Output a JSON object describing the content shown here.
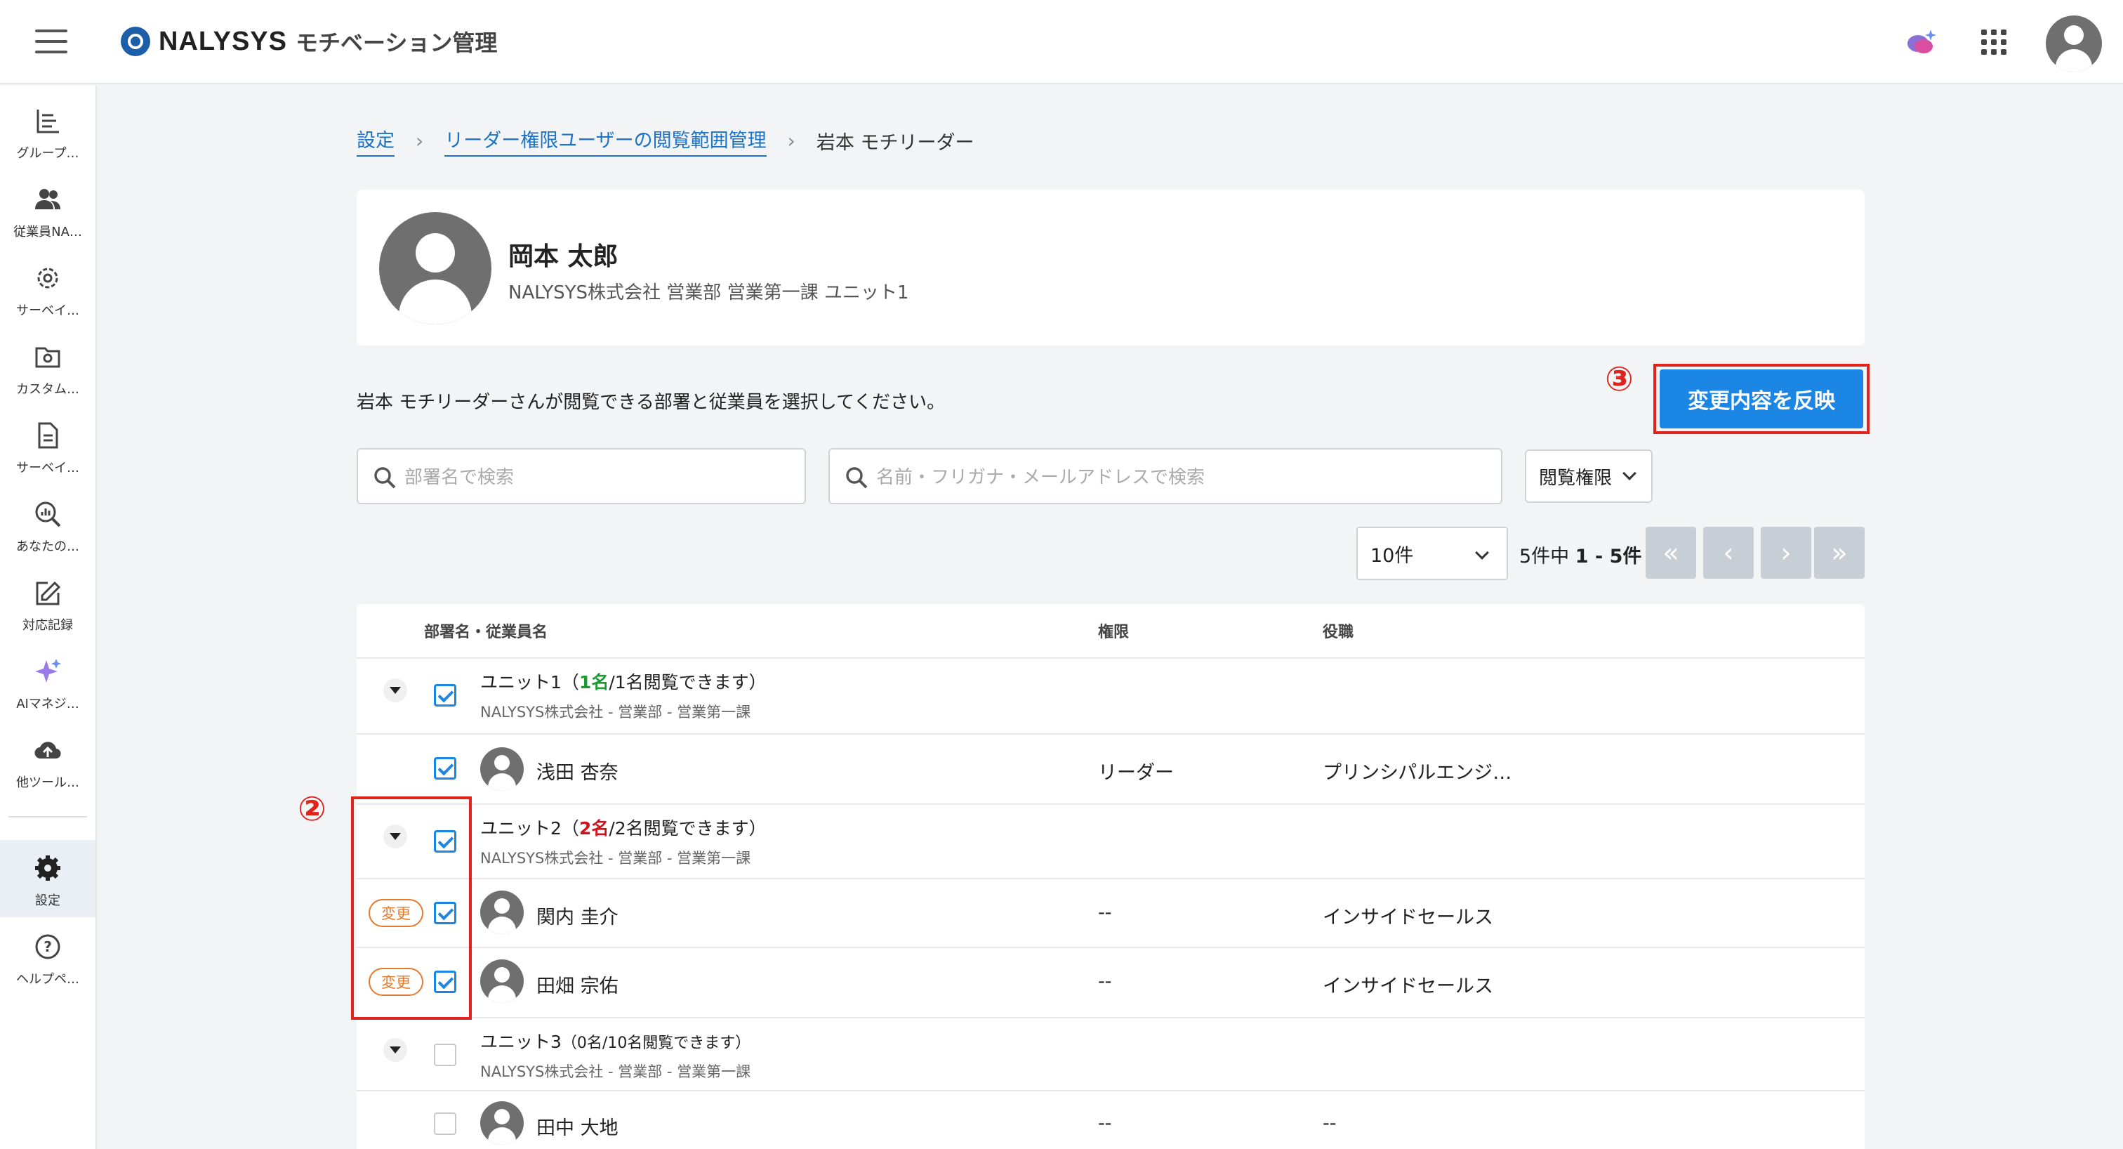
{
  "header": {
    "brand": "NALYSYS",
    "product": "モチベーション管理",
    "icons": [
      "menu-icon",
      "chat-sparkle-icon",
      "apps-grid-icon",
      "user-avatar-icon"
    ]
  },
  "sidebar": {
    "items": [
      {
        "label": "グループ…",
        "icon": "bar-list-icon"
      },
      {
        "label": "従業員NA…",
        "icon": "people-icon"
      },
      {
        "label": "サーベイ…",
        "icon": "gear-outline-icon"
      },
      {
        "label": "カスタム…",
        "icon": "folder-gear-icon"
      },
      {
        "label": "サーベイ…",
        "icon": "document-icon"
      },
      {
        "label": "あなたの…",
        "icon": "search-chart-icon"
      },
      {
        "label": "対応記録",
        "icon": "edit-icon"
      },
      {
        "label": "AIマネジ…",
        "icon": "sparkle-icon"
      },
      {
        "label": "他ツール…",
        "icon": "cloud-upload-icon"
      },
      {
        "label": "設定",
        "icon": "gear-icon"
      },
      {
        "label": "ヘルプペ…",
        "icon": "help-icon"
      }
    ]
  },
  "breadcrumb": {
    "items": [
      "設定",
      "リーダー権限ユーザーの閲覧範囲管理"
    ],
    "current": "岩本 モチリーダー"
  },
  "profile": {
    "name": "岡本 太郎",
    "org": "NALYSYS株式会社 営業部 営業第一課 ユニット1"
  },
  "instruction": "岩本 モチリーダーさんが閲覧できる部署と従業員を選択してください。",
  "apply_button": "変更内容を反映",
  "markers": {
    "apply": "③",
    "change": "②"
  },
  "search": {
    "dept_placeholder": "部署名で検索",
    "emp_placeholder": "名前・フリガナ・メールアドレスで検索",
    "filter_label": "閲覧権限"
  },
  "pagination": {
    "per_page": "10件",
    "info_prefix": "5件中",
    "info_range": "1 - 5件",
    "first": "«",
    "prev": "‹",
    "next": "›",
    "last": "»"
  },
  "table": {
    "columns": [
      "部署名・従業員名",
      "権限",
      "役職"
    ],
    "units": [
      {
        "name": "ユニット1",
        "count_open": "（",
        "count_selected": "1名",
        "count_rest": "/1名閲覧できます）",
        "path": "NALYSYS株式会社 - 営業部 - 営業第一課",
        "checked": true,
        "employees": [
          {
            "name": "浅田 杏奈",
            "role": "リーダー",
            "title": "プリンシパルエンジ…",
            "checked": true,
            "changed": false
          }
        ]
      },
      {
        "name": "ユニット2",
        "count_open": "（",
        "count_selected": "2名",
        "count_rest": "/2名閲覧できます）",
        "path": "NALYSYS株式会社 - 営業部 - 営業第一課",
        "checked": true,
        "employees": [
          {
            "name": "関内 圭介",
            "role": "--",
            "title": "インサイドセールス",
            "checked": true,
            "changed": true
          },
          {
            "name": "田畑 宗佑",
            "role": "--",
            "title": "インサイドセールス",
            "checked": true,
            "changed": true
          }
        ]
      },
      {
        "name": "ユニット3",
        "count_text": "（0名/10名閲覧できます）",
        "path": "NALYSYS株式会社 - 営業部 - 営業第一課",
        "checked": false,
        "employees": [
          {
            "name": "田中 大地",
            "role": "--",
            "title": "--",
            "checked": false,
            "changed": false
          }
        ]
      }
    ],
    "change_badge": "変更"
  },
  "colors": {
    "primary": "#1c86e4",
    "annotation_red": "#e0231c",
    "badge_orange": "#e67a2e",
    "count_green": "#1c9b2f",
    "count_red": "#d0121b"
  }
}
